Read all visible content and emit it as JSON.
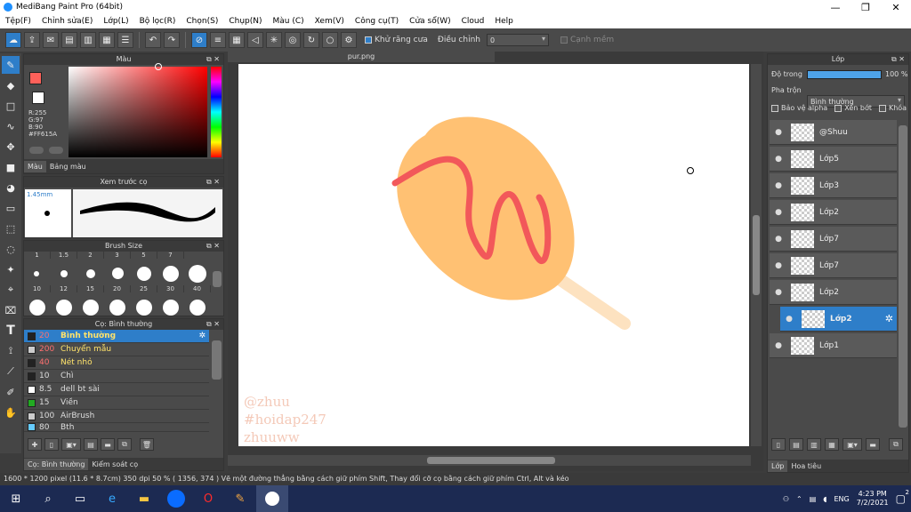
{
  "window": {
    "title": "MediBang Paint Pro (64bit)"
  },
  "menu": [
    "Tệp(F)",
    "Chỉnh sửa(E)",
    "Lớp(L)",
    "Bộ lọc(R)",
    "Chọn(S)",
    "Chụp(N)",
    "Màu (C)",
    "Xem(V)",
    "Công cụ(T)",
    "Cửa sổ(W)",
    "Cloud",
    "Help"
  ],
  "toolbar": {
    "antialias_label": "Khử răng cưa",
    "adjust_label": "Điều chỉnh",
    "adjust_value": "0",
    "edge_label": "Cạnh mềm"
  },
  "color_panel": {
    "title": "Màu",
    "r": "R:255",
    "g": "G:97",
    "b": "B:90",
    "hex": "#FF615A",
    "tab_color": "Màu",
    "tab_palette": "Bảng màu",
    "current_color": "#ff615a"
  },
  "preview_panel": {
    "title": "Xem trước cọ",
    "size": "1.45mm"
  },
  "brush_size_panel": {
    "title": "Brush Size",
    "row1": [
      "1",
      "1.5",
      "2",
      "3",
      "5",
      "7"
    ],
    "row2": [
      "10",
      "12",
      "15",
      "20",
      "25",
      "30",
      "40"
    ]
  },
  "brush_panel": {
    "title": "Cọ: Bình thường",
    "items": [
      {
        "size": "20",
        "name": "Bình thường",
        "color": "#222222"
      },
      {
        "size": "200",
        "name": "Chuyển mẫu",
        "color": "#cccccc"
      },
      {
        "size": "40",
        "name": "Nét nhỏ",
        "color": "#222222"
      },
      {
        "size": "10",
        "name": "Chì",
        "color": "#222222"
      },
      {
        "size": "8.5",
        "name": "dell bt sài",
        "color": "#ffffff"
      },
      {
        "size": "15",
        "name": "Viền",
        "color": "#22aa22"
      },
      {
        "size": "100",
        "name": "AirBrush",
        "color": "#cccccc"
      },
      {
        "size": "80",
        "name": "Bth",
        "color": "#66ccff"
      }
    ],
    "tab_brush": "Cọ: Bình thường",
    "tab_control": "Kiểm soát cọ"
  },
  "canvas": {
    "tab_name": "pur.png",
    "watermark": [
      "@zhuu",
      "#hoidap247",
      "zhuuww"
    ]
  },
  "layer_panel": {
    "title": "Lớp",
    "opacity_label": "Độ trong",
    "opacity_value": "100 %",
    "opacity_fraction": 1.0,
    "blend_label": "Pha trộn",
    "blend_value": "Bình thường",
    "protect_alpha": "Bảo vệ alpha",
    "clip": "Xén bớt",
    "lock": "Khóa",
    "layers": [
      "@Shuu",
      "Lớp5",
      "Lớp3",
      "Lớp2",
      "Lớp7",
      "Lớp7",
      "Lớp2",
      "Lớp2",
      "Lớp1"
    ],
    "tab_layer": "Lớp",
    "tab_nav": "Hoa tiêu"
  },
  "status": {
    "text": "1600 * 1200 pixel   (11.6 * 8.7cm)  350 dpi  50 %   ( 1356, 374 )  Vẽ một đường thẳng bằng cách giữ phím Shift, Thay đổi cỡ cọ bằng cách giữ phím Ctrl, Alt và kéo"
  },
  "taskbar": {
    "lang": "ENG",
    "time": "4:23 PM",
    "date": "7/2/2021",
    "notif": "2"
  }
}
